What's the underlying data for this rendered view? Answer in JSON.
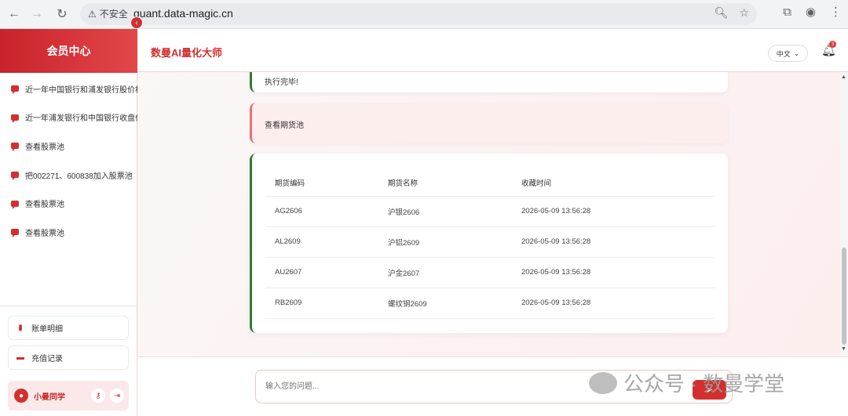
{
  "browser": {
    "security_label": "不安全",
    "url": "quant.data-magic.cn"
  },
  "sidebar": {
    "title": "会员中心",
    "items": [
      {
        "label": "近一年中国银行和浦发银行股价相"
      },
      {
        "label": "近一年浦发银行和中国银行收盘价"
      },
      {
        "label": "查看股票池"
      },
      {
        "label": "把002271、600838加入股票池"
      },
      {
        "label": "查看股票池"
      },
      {
        "label": "查看股票池"
      }
    ],
    "billing_label": "账单明细",
    "recharge_label": "充值记录",
    "user_name": "小曼同学"
  },
  "header": {
    "app_title": "数曼AI量化大师",
    "language": "中文",
    "notification_count": "3"
  },
  "chat": {
    "prev_message": "执行完毕!",
    "user_message": "查看期货池",
    "table": {
      "headers": [
        "期货编码",
        "期货名称",
        "收藏时间"
      ],
      "rows": [
        [
          "AG2606",
          "沪银2606",
          "2026-05-09 13:56:28"
        ],
        [
          "AL2609",
          "沪铝2609",
          "2026-05-09 13:56:28"
        ],
        [
          "AU2607",
          "沪金2607",
          "2026-05-09 13:56:28"
        ],
        [
          "RB2609",
          "螺纹钢2609",
          "2026-05-09 13:56:28"
        ]
      ]
    }
  },
  "input": {
    "placeholder": "输入您的问题..."
  },
  "watermark": "公众号 · 数曼学堂",
  "colors": {
    "accent": "#d32f2f",
    "bot_border": "#2e7d32"
  }
}
